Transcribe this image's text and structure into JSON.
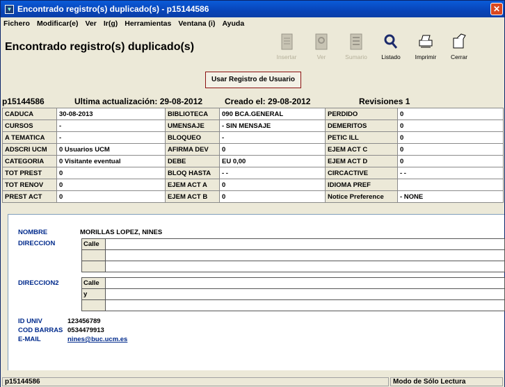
{
  "window": {
    "title": "Encontrado registro(s) duplicado(s) - p15144586"
  },
  "menu": [
    "Fichero",
    "Modificar(e)",
    "Ver",
    "Ir(g)",
    "Herramientas",
    "Ventana (i)",
    "Ayuda"
  ],
  "header": {
    "title": "Encontrado registro(s) duplicado(s)"
  },
  "toolbar": {
    "insertar": "Insertar",
    "ver": "Ver",
    "sumario": "Sumario",
    "listado": "Listado",
    "imprimir": "Imprimir",
    "cerrar": "Cerrar"
  },
  "user_button": "Usar Registro de Usuario",
  "info": {
    "id": "p15144586",
    "updated": "Ultima actualización: 29-08-2012",
    "created": "Creado el: 29-08-2012",
    "revisions": "Revisiones 1"
  },
  "grid": {
    "r0": [
      "CADUCA",
      "30-08-2013",
      "BIBLIOTECA",
      "090     BCA.GENERAL",
      "PERDIDO",
      "0"
    ],
    "r1": [
      "CURSOS",
      "-",
      "UMENSAJE",
      "-    SIN MENSAJE",
      "DEMERITOS",
      "0"
    ],
    "r2": [
      "A TEMATICA",
      "-",
      "BLOQUEO",
      "-",
      "PETIC ILL",
      "0"
    ],
    "r3": [
      "ADSCRI UCM",
      "0  Usuarios UCM",
      "AFIRMA DEV",
      "0",
      "EJEM ACT C",
      "0"
    ],
    "r4": [
      "CATEGORIA",
      "0  Visitante eventual",
      "DEBE",
      "EU 0,00",
      "EJEM ACT D",
      "0"
    ],
    "r5": [
      "TOT PREST",
      "0",
      "BLOQ HASTA",
      "- -",
      "CIRCACTIVE",
      "- -"
    ],
    "r6": [
      "TOT RENOV",
      "0",
      "EJEM ACT A",
      "0",
      "IDIOMA PREF",
      ""
    ],
    "r7": [
      "PREST ACT",
      "0",
      "EJEM ACT B",
      "0",
      "Notice Preference",
      "-    NONE"
    ]
  },
  "person": {
    "nombre_label": "NOMBRE",
    "nombre": "MORILLAS LOPEZ, NINES",
    "direccion_label": "DIRECCION",
    "direccion2_label": "DIRECCION2",
    "calle": "Calle",
    "y": "y",
    "id_label": "ID UNIV",
    "id": "123456789",
    "cod_label": "COD BARRAS",
    "cod": "0534479913",
    "email_label": "E-MAIL",
    "email": "nines@buc.ucm.es"
  },
  "status": {
    "left": "p15144586",
    "right": "Modo de Sólo Lectura"
  }
}
